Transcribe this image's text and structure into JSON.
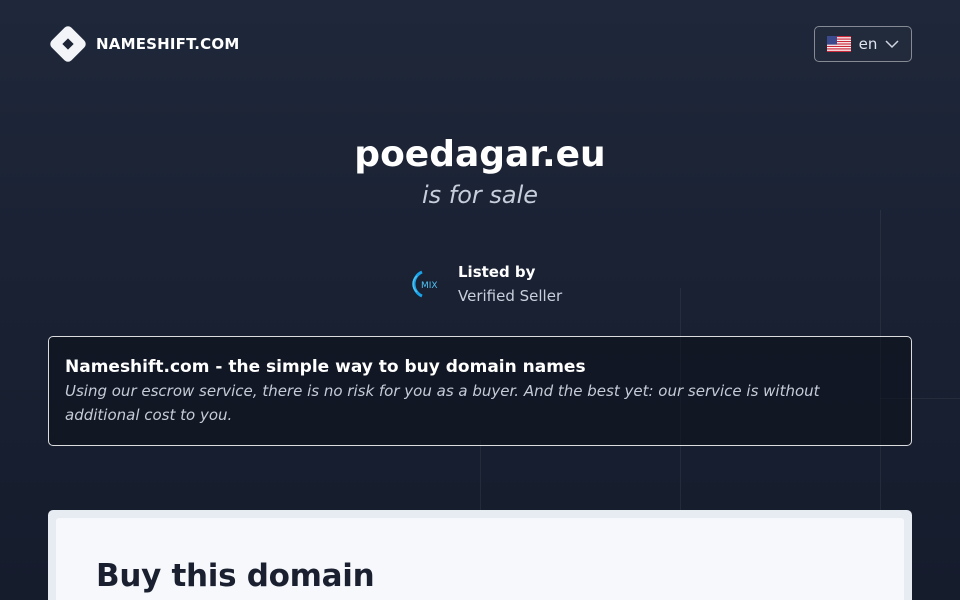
{
  "header": {
    "brand_name": "NAMESHIFT.COM",
    "brand_icon": "nameshift-diamond-logo",
    "language": {
      "flag_icon": "us-flag-icon",
      "label": "en",
      "chevron_icon": "chevron-down-icon"
    }
  },
  "hero": {
    "domain": "poedagar.eu",
    "subtitle": "is for sale"
  },
  "listed_by": {
    "logo_icon": "mix-seller-logo",
    "logo_text": "MIX",
    "title": "Listed by",
    "seller": "Verified Seller"
  },
  "info": {
    "title": "Nameshift.com - the simple way to buy domain names",
    "text": "Using our escrow service, there is no risk for you as a buyer. And the best yet: our service is without additional cost to you."
  },
  "buy": {
    "title": "Buy this domain"
  },
  "colors": {
    "background": "#1a2234",
    "card": "#f6f8fb",
    "accent_blue": "#1aa3e8"
  }
}
